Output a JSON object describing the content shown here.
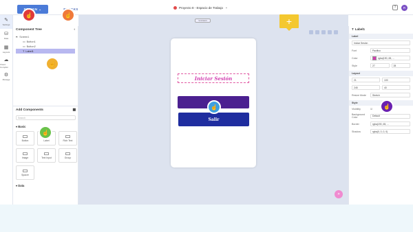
{
  "topbar": {
    "tabs": [
      {
        "label": "DESIGN",
        "active": true
      },
      {
        "label": "BLOCKS",
        "active": false
      }
    ],
    "project_name": "Proyecto 8 - Espacio de Trabajo",
    "avatar_initial": "R"
  },
  "rail": {
    "items": [
      {
        "label": "Settings",
        "icon": "pencil-icon"
      },
      {
        "label": "Data",
        "icon": "database-icon"
      },
      {
        "label": "Layouts",
        "icon": "layout-icon"
      },
      {
        "label": "Cloud Compiler",
        "icon": "cloud-icon"
      },
      {
        "label": "Manage",
        "icon": "manage-icon"
      }
    ]
  },
  "component_tree": {
    "title": "Component Tree",
    "screen": "Screen1",
    "items": [
      "Button1",
      "Button2",
      "Label1"
    ],
    "selected": "Label1"
  },
  "add_components": {
    "title": "Add Components",
    "search_placeholder": "Search",
    "basic_title": "Basic",
    "basic": [
      "Button",
      "Label",
      "Rich Text",
      "Image",
      "Text Input",
      "Group",
      "Spacer"
    ],
    "data_title": "Data"
  },
  "canvas": {
    "version_badge": "SCREEN",
    "label_text": "Iniciar Sesión",
    "button1_text": "",
    "button2_text": "Salir"
  },
  "properties": {
    "title": "Label1",
    "label_section": "Label",
    "text_value": "Iniciar Sesión",
    "font": "Pacifico",
    "color_label": "Color",
    "color_value": "rgba(190, 65, ...",
    "text_color": "#d23fb0",
    "size_value": "27",
    "line_value": "28",
    "layout_section": "Layout",
    "x": "21",
    "y": "100",
    "w": "245",
    "h": "40",
    "resize_label": "Resize Mode",
    "resize_value": "Stretch",
    "style_section": "Style",
    "visibility_label": "Visibility",
    "bg_label": "Background Color",
    "bg_value": "Default",
    "border_label": "Border",
    "border_value": "rgba(190, 65, ...",
    "shadow_label": "Shadow",
    "shadow_value": "rgba(0, 0, 0, 0)"
  },
  "overlay_colors": {
    "red": "#e03a3a",
    "orange": "#f07a3a",
    "amber": "#f0b030",
    "green": "#6ac24a",
    "blue": "#3fa0e0",
    "purple": "#6a20b0"
  }
}
